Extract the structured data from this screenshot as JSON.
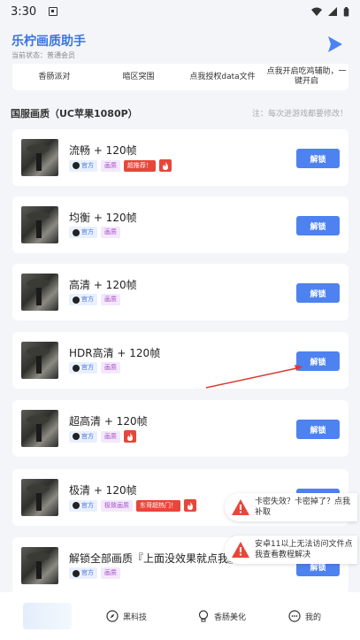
{
  "status": {
    "time": "3:30"
  },
  "app": {
    "title": "乐柠画质助手",
    "subtitle": "当前状态：普通会员"
  },
  "features": [
    {
      "label": "香肠派对"
    },
    {
      "label": "暗区突围"
    },
    {
      "label": "点我授权data文件"
    },
    {
      "label": "点我开启吃鸡辅助，一键开启"
    }
  ],
  "section": {
    "title": "国服画质（UC苹果1080P）",
    "note": "注：每次进游戏都要修改！"
  },
  "cards": [
    {
      "title": "流畅 + 120帧",
      "tags": [
        "官方",
        "画质"
      ],
      "hot": "超推荐！",
      "fire": true,
      "button": "解锁"
    },
    {
      "title": "均衡 + 120帧",
      "tags": [
        "官方",
        "画质"
      ],
      "hot": "",
      "fire": false,
      "button": "解锁"
    },
    {
      "title": "高清 + 120帧",
      "tags": [
        "官方",
        "画质"
      ],
      "hot": "",
      "fire": false,
      "button": "解锁"
    },
    {
      "title": "HDR高清 + 120帧",
      "tags": [
        "官方",
        "画质"
      ],
      "hot": "",
      "fire": false,
      "button": "解锁"
    },
    {
      "title": "超高清 + 120帧",
      "tags": [
        "官方",
        "画质"
      ],
      "hot": "",
      "fire": true,
      "button": "解锁"
    },
    {
      "title": "极清 + 120帧",
      "tags": [
        "官方",
        "极致画质"
      ],
      "hot": "东哥超热门！",
      "fire": true,
      "button": "解锁"
    },
    {
      "title": "解锁全部画质『上面没效果就点我』",
      "tags": [
        "官方",
        "画质"
      ],
      "hot": "",
      "fire": false,
      "button": "解锁"
    }
  ],
  "toasts": [
    {
      "message": "卡密失效？卡密掉了？点我补取"
    },
    {
      "message": "安卓11以上无法访问文件点我查看教程解决"
    }
  ],
  "nav": [
    {
      "label": "黑科技",
      "icon": "compass-icon"
    },
    {
      "label": "香肠美化",
      "icon": "bulb-icon"
    },
    {
      "label": "我的",
      "icon": "dots-icon"
    }
  ],
  "colors": {
    "accent": "#4d82f0",
    "title": "#3c74e0",
    "hot": "#e8463a"
  }
}
